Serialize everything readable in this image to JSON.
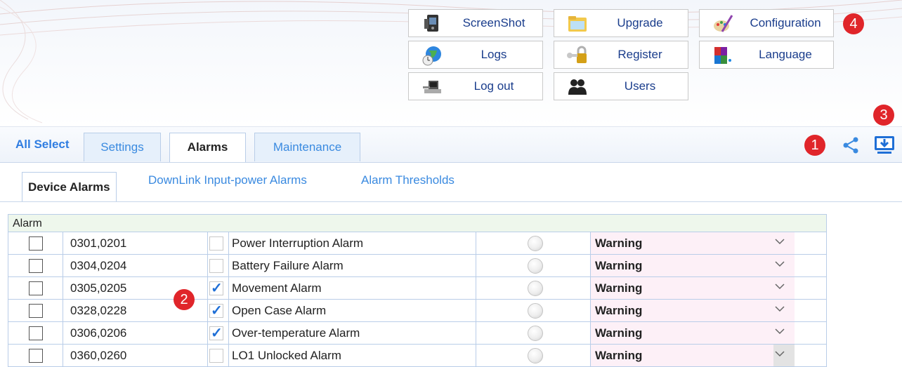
{
  "toolbar": {
    "screenshot": "ScreenShot",
    "upgrade": "Upgrade",
    "configuration": "Configuration",
    "logs": "Logs",
    "register": "Register",
    "language": "Language",
    "logout": "Log out",
    "users": "Users"
  },
  "callouts": {
    "c1": "1",
    "c2": "2",
    "c3": "3",
    "c4": "4"
  },
  "tabs": {
    "all_select": "All Select",
    "settings": "Settings",
    "alarms": "Alarms",
    "maintenance": "Maintenance"
  },
  "subtabs": {
    "device_alarms": "Device Alarms",
    "downlink": "DownLink Input-power Alarms",
    "thresholds": "Alarm Thresholds"
  },
  "table": {
    "header": "Alarm",
    "rows": [
      {
        "selected": false,
        "code": "0301,0201",
        "enabled": false,
        "name": "Power Interruption Alarm",
        "level": "Warning"
      },
      {
        "selected": false,
        "code": "0304,0204",
        "enabled": false,
        "name": "Battery Failure Alarm",
        "level": "Warning"
      },
      {
        "selected": false,
        "code": "0305,0205",
        "enabled": true,
        "name": "Movement Alarm",
        "level": "Warning"
      },
      {
        "selected": false,
        "code": "0328,0228",
        "enabled": true,
        "name": "Open Case Alarm",
        "level": "Warning"
      },
      {
        "selected": false,
        "code": "0306,0206",
        "enabled": true,
        "name": "Over-temperature Alarm",
        "level": "Warning"
      },
      {
        "selected": false,
        "code": "0360,0260",
        "enabled": false,
        "name": "LO1 Unlocked Alarm",
        "level": "Warning"
      }
    ]
  },
  "colors": {
    "accent": "#3a8ae0",
    "callout": "#e0252a",
    "link": "#1a3d8c"
  }
}
